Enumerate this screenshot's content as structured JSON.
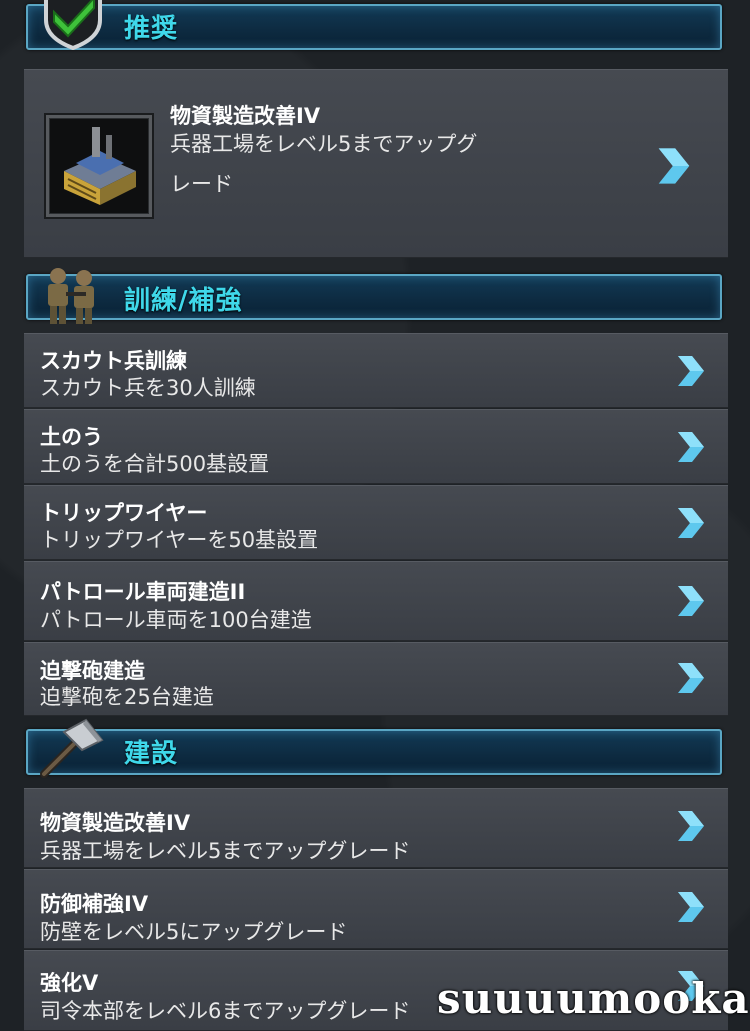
{
  "sections": {
    "recommended": {
      "title": "推奨",
      "icon": "green-check-shield-icon"
    },
    "training": {
      "title": "訓練/補強",
      "icon": "soldiers-icon"
    },
    "construction": {
      "title": "建設",
      "icon": "hammer-icon"
    }
  },
  "featured": {
    "title": "物資製造改善IV",
    "desc_line1": "兵器工場をレベル5までアップグ",
    "desc_line2": "レード",
    "thumbnail": "weapons-factory-icon"
  },
  "training_items": [
    {
      "title": "スカウト兵訓練",
      "desc": "スカウト兵を30人訓練"
    },
    {
      "title": "土のう",
      "desc": "土のうを合計500基設置"
    },
    {
      "title": "トリップワイヤー",
      "desc": "トリップワイヤーを50基設置"
    },
    {
      "title": "パトロール車両建造II",
      "desc": "パトロール車両を100台建造"
    },
    {
      "title": "迫撃砲建造",
      "desc": "迫撃砲を25台建造"
    }
  ],
  "construction_items": [
    {
      "title": "物資製造改善IV",
      "desc": "兵器工場をレベル5までアップグレード"
    },
    {
      "title": "防御補強IV",
      "desc": "防壁をレベル5にアップグレード"
    },
    {
      "title": "強化V",
      "desc": "司令本部をレベル6までアップグレード"
    }
  ],
  "watermark": "suuuumooka",
  "colors": {
    "accent_cyan": "#3fd8ea",
    "arrow_blue": "#5ec8ee",
    "card_bg": "#42464d",
    "header_border": "#5aa6c4"
  },
  "arrow_icon": "chevron-right-icon"
}
